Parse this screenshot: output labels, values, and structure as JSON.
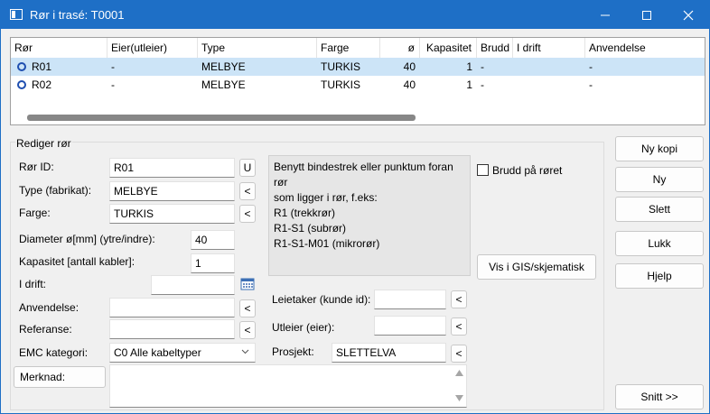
{
  "window": {
    "title": "Rør i trasé: T0001"
  },
  "grid": {
    "columns": [
      "Rør",
      "Eier(utleier)",
      "Type",
      "Farge",
      "ø",
      "Kapasitet",
      "Brudd",
      "I drift",
      "Anvendelse"
    ],
    "rows": [
      {
        "ror": "R01",
        "eier": "-",
        "type": "MELBYE",
        "farge": "TURKIS",
        "diameter": "40",
        "kapasitet": "1",
        "brudd": "-",
        "idrift": "",
        "anvendelse": "-"
      },
      {
        "ror": "R02",
        "eier": "-",
        "type": "MELBYE",
        "farge": "TURKIS",
        "diameter": "40",
        "kapasitet": "1",
        "brudd": "-",
        "idrift": "",
        "anvendelse": "-"
      }
    ]
  },
  "form": {
    "group_title": "Rediger rør",
    "ror_id": {
      "label": "Rør ID:",
      "value": "R01",
      "button": "U"
    },
    "type": {
      "label": "Type (fabrikat):",
      "value": "MELBYE",
      "button": "<"
    },
    "farge": {
      "label": "Farge:",
      "value": "TURKIS",
      "button": "<"
    },
    "diameter": {
      "label": "Diameter ø[mm] (ytre/indre):",
      "value": "40"
    },
    "kapasitet": {
      "label": "Kapasitet [antall kabler]:",
      "value": "1"
    },
    "idrift": {
      "label": "I drift:",
      "value": ""
    },
    "anvendelse": {
      "label": "Anvendelse:",
      "value": "",
      "button": "<"
    },
    "referanse": {
      "label": "Referanse:",
      "value": "",
      "button": "<"
    },
    "emc": {
      "label": "EMC kategori:",
      "value": "C0 Alle kabeltyper"
    },
    "merknad": {
      "button": "Merknad:",
      "value": ""
    },
    "info_lines": [
      "Benytt bindestrek eller punktum foran rør",
      "som ligger i rør, f.eks:",
      "R1 (trekkrør)",
      "R1-S1 (subrør)",
      "R1-S1-M01 (mikrorør)"
    ],
    "brudd": {
      "label": "Brudd på røret",
      "checked": false
    },
    "vis_gis": "Vis i GIS/skjematisk",
    "leietaker": {
      "label": "Leietaker (kunde id):",
      "value": "",
      "button": "<"
    },
    "utleier": {
      "label": "Utleier (eier):",
      "value": "",
      "button": "<"
    },
    "prosjekt": {
      "label": "Prosjekt:",
      "value": "SLETTELVA",
      "button": "<"
    }
  },
  "actions": {
    "ny_kopi": "Ny kopi",
    "ny": "Ny",
    "slett": "Slett",
    "lukk": "Lukk",
    "hjelp": "Hjelp",
    "snitt": "Snitt >>"
  },
  "colors": {
    "titlebar": "#1e6fc6",
    "selected_row": "#cce4f7",
    "ring": "#1f4fb0"
  }
}
